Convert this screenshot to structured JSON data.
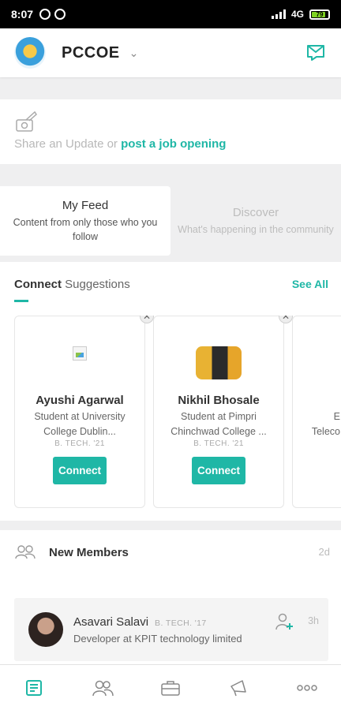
{
  "status_bar": {
    "time": "8:07",
    "network": "4G",
    "battery": "79"
  },
  "header": {
    "org_name": "PCCOE"
  },
  "composer": {
    "prompt": "Share an Update or ",
    "link": "post a job opening"
  },
  "feed_tabs": [
    {
      "title": "My Feed",
      "subtitle": "Content from only those who you follow",
      "active": true
    },
    {
      "title": "Discover",
      "subtitle": "What's happening in the community",
      "active": false
    }
  ],
  "suggestions": {
    "heading_bold": "Connect",
    "heading_rest": " Suggestions",
    "see_all": "See All",
    "cards": [
      {
        "name": "Ayushi Agarwal",
        "description": "Student at University College Dublin...",
        "batch": "B. TECH. '21",
        "button": "Connect"
      },
      {
        "name": "Nikhil Bhosale",
        "description": "Student at Pimpri Chinchwad College ...",
        "batch": "B. TECH. '21",
        "button": "Connect"
      }
    ],
    "peek": {
      "line1": "E",
      "line2": "Teleco"
    }
  },
  "new_members": {
    "label": "New Members",
    "age": "2d",
    "member": {
      "name": "Asavari Salavi",
      "batch": "B. TECH. '17",
      "role": "Developer at KPIT technology limited",
      "age": "3h"
    }
  },
  "bottom_nav": [
    "feed-icon",
    "people-icon",
    "briefcase-icon",
    "megaphone-icon",
    "more-icon"
  ],
  "colors": {
    "accent": "#1fb7a6"
  }
}
